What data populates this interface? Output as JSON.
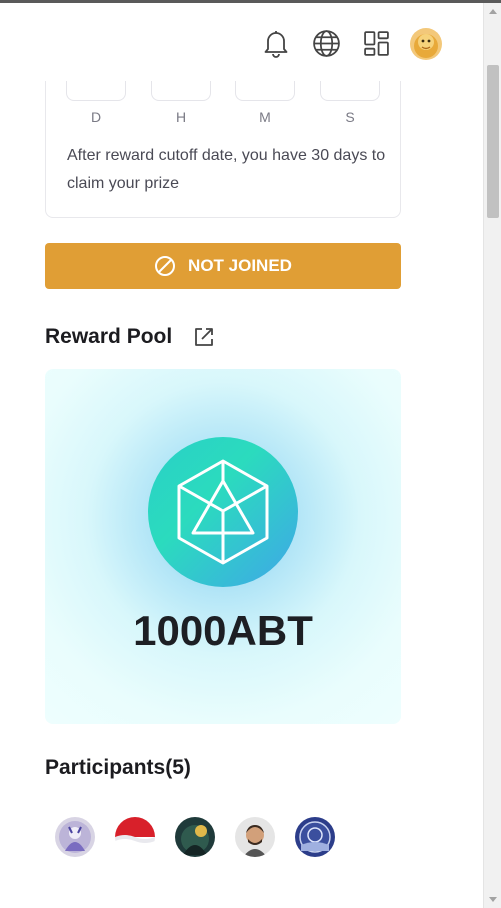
{
  "countdown": {
    "units": [
      {
        "label": "D"
      },
      {
        "label": "H"
      },
      {
        "label": "M"
      },
      {
        "label": "S"
      }
    ],
    "claim_note": "After reward cutoff date, you have 30 days to claim your prize"
  },
  "status_button": {
    "label": "NOT JOINED",
    "icon": "ban-icon",
    "color": "#e09e35"
  },
  "reward_pool": {
    "title": "Reward Pool",
    "link_icon": "external-link-icon",
    "amount": "1000ABT",
    "token_icon": "arcblock-token-icon"
  },
  "participants": {
    "title": "Participants(5)",
    "avatars": [
      "participant-avatar-1",
      "participant-avatar-2",
      "participant-avatar-3",
      "participant-avatar-4",
      "participant-avatar-5"
    ]
  },
  "header": {
    "icons": [
      "bell-icon",
      "globe-icon",
      "apps-grid-icon",
      "user-avatar"
    ]
  }
}
